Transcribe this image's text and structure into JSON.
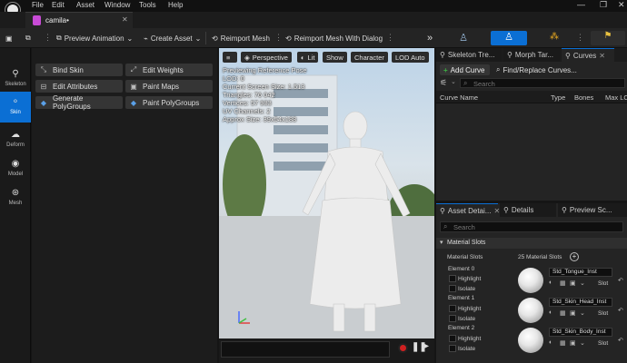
{
  "menu": {
    "items": [
      "File",
      "Edit",
      "Asset",
      "Window",
      "Tools",
      "Help"
    ]
  },
  "tab": {
    "title": "camila•"
  },
  "toolbar": {
    "preview_animation": "Preview Animation",
    "create_asset": "Create Asset",
    "reimport_mesh": "Reimport Mesh",
    "reimport_mesh_with_dialog": "Reimport Mesh With Dialog"
  },
  "rail": {
    "items": [
      "Skeleton",
      "Skin",
      "Deform",
      "Model",
      "Mesh"
    ],
    "active": "Skin"
  },
  "tools": {
    "bind_skin": "Bind Skin",
    "edit_weights": "Edit Weights",
    "edit_attributes": "Edit Attributes",
    "paint_maps": "Paint Maps",
    "generate_polygroups": "Generate PolyGroups",
    "paint_polygroups": "Paint PolyGroups"
  },
  "viewport": {
    "perspective": "Perspective",
    "lit": "Lit",
    "show": "Show",
    "character": "Character",
    "lod": "LOD Auto",
    "overlay_lines": [
      "Previewing Reference Pose",
      "LOD: 0",
      "Current Screen Size: 1.513",
      "Triangles: 76 042",
      "Vertices: 57 983",
      "UV Channels: 2",
      "Approx Size: 39x54x188"
    ]
  },
  "curves_panel": {
    "tabs": [
      "Skeleton Tre...",
      "Morph Tar...",
      "Curves"
    ],
    "add_curve": "Add Curve",
    "find_replace": "Find/Replace Curves...",
    "search_placeholder": "Search",
    "columns": [
      "Curve Name",
      "Type",
      "Bones",
      "Max LO"
    ]
  },
  "details_panel": {
    "tabs": [
      "Asset Detai...",
      "Details",
      "Preview Sc..."
    ],
    "search_placeholder": "Search",
    "section": "Material Slots",
    "material_slots_label": "Material Slots",
    "material_slots_count": "25 Material Slots",
    "highlight": "Highlight",
    "isolate": "Isolate",
    "slot_label": "Slot",
    "elements": [
      {
        "name": "Element 0",
        "material": "Std_Tongue_Inst"
      },
      {
        "name": "Element 1",
        "material": "Std_Skin_Head_Inst"
      },
      {
        "name": "Element 2",
        "material": "Std_Skin_Body_Inst"
      }
    ]
  },
  "colors": {
    "accent": "#0b6fd4",
    "add_green": "#3cb043",
    "toolbar_orange": "#e8a820"
  }
}
